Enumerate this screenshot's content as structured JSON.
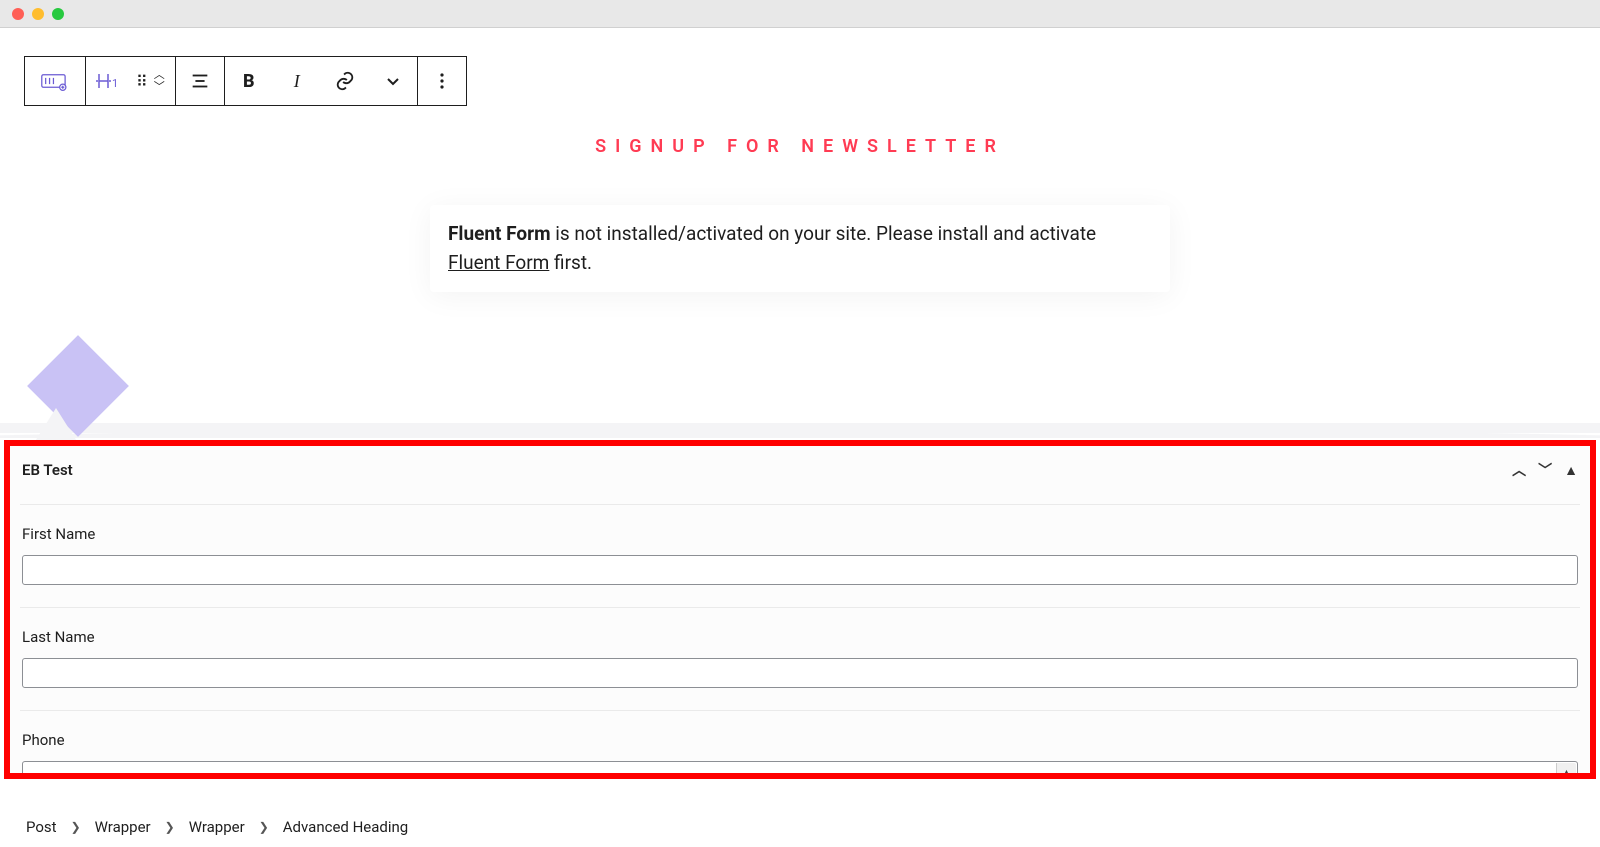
{
  "toolbar": {
    "block_type": "Advanced Heading",
    "bold": "B",
    "italic": "I"
  },
  "heading": {
    "text": "SIGNUP FOR NEWSLETTER"
  },
  "warning": {
    "strong": "Fluent Form",
    "middle": " is not installed/activated on your site. Please install and activate ",
    "link": "Fluent Form",
    "tail": " first."
  },
  "panel": {
    "title": "EB Test",
    "fields": [
      {
        "label": "First Name",
        "value": ""
      },
      {
        "label": "Last Name",
        "value": ""
      },
      {
        "label": "Phone",
        "value": ""
      }
    ]
  },
  "breadcrumbs": [
    "Post",
    "Wrapper",
    "Wrapper",
    "Advanced Heading"
  ]
}
